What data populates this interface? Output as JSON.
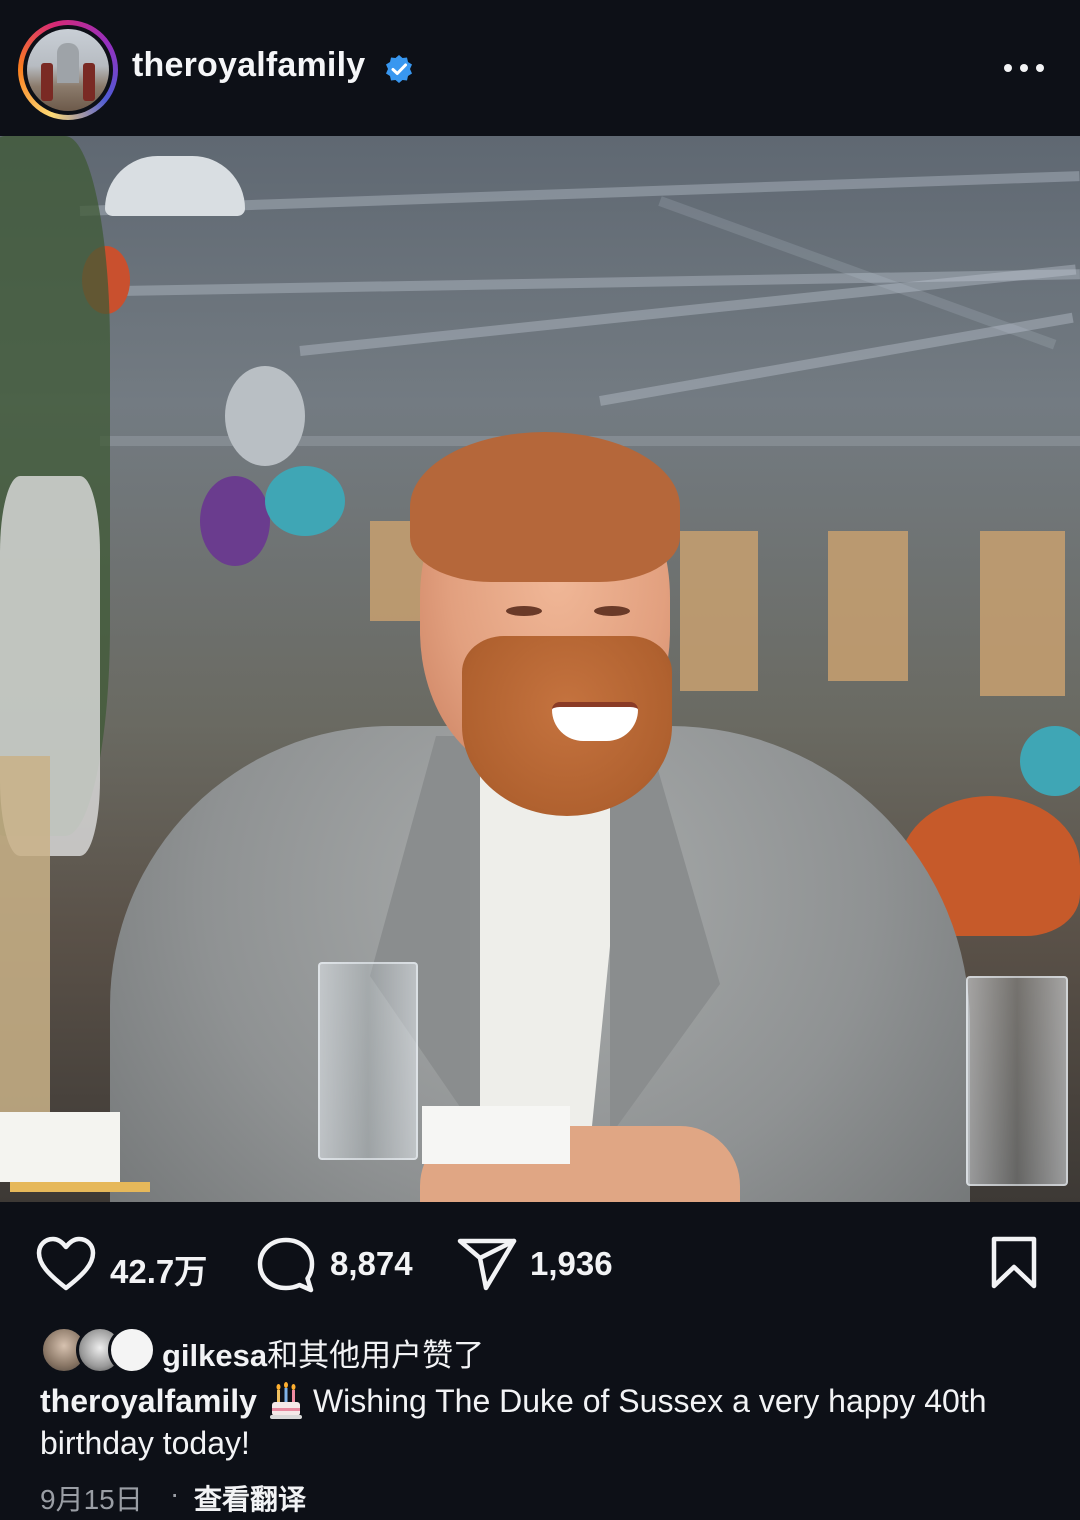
{
  "post": {
    "username": "theroyalfamily",
    "verified": true,
    "more_icon": "more-horizontal-icon"
  },
  "actions": {
    "likes": "42.7万",
    "comments": "8,874",
    "shares": "1,936",
    "like_icon": "heart-icon",
    "comment_icon": "comment-bubble-icon",
    "share_icon": "paper-plane-icon",
    "save_icon": "bookmark-icon"
  },
  "liked_by": {
    "user": "gilkesa",
    "suffix": "和其他用户赞了"
  },
  "caption": {
    "user": "theroyalfamily",
    "emoji": "birthday-cake-icon",
    "text": "Wishing The Duke of Sussex a very happy 40th birthday today!"
  },
  "footer": {
    "date": "9月15日",
    "separator": "·",
    "translate": "查看翻译"
  },
  "colors": {
    "background": "#0d1017",
    "text": "#f2f3f5",
    "muted": "#9a9ea5",
    "verified": "#3897f0"
  }
}
